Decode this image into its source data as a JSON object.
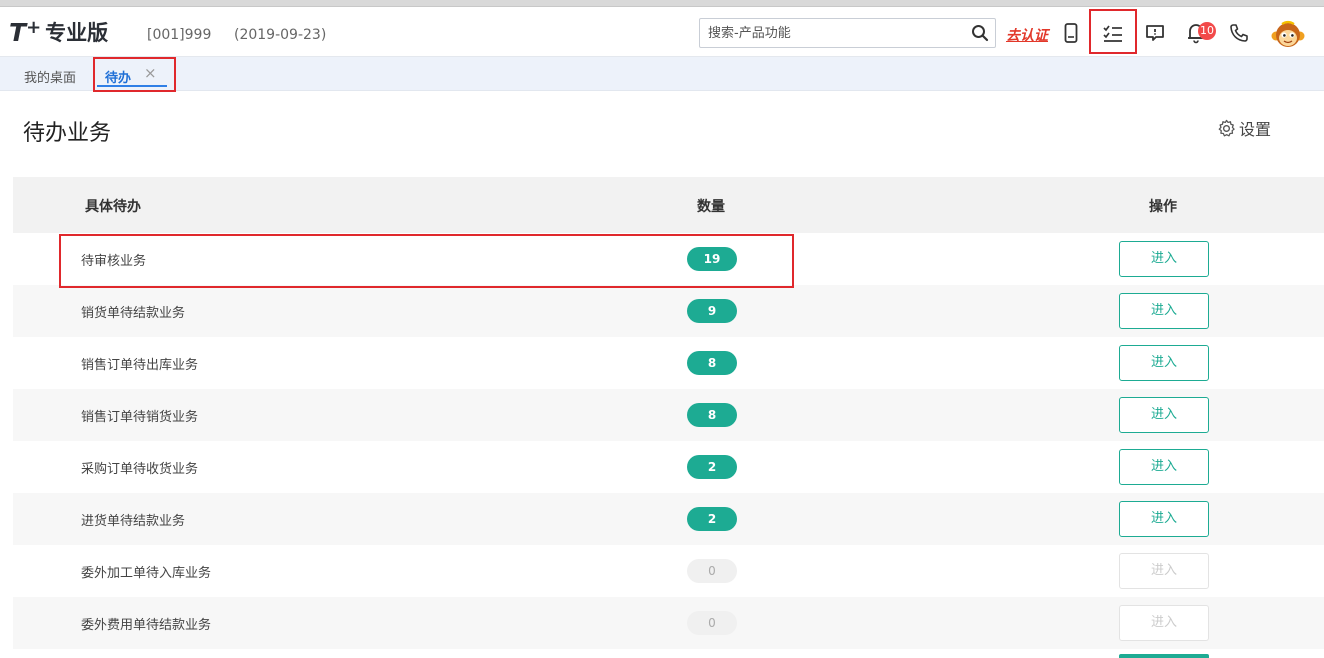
{
  "header": {
    "logo_t": "T",
    "logo_plus": "+",
    "edition": "专业版",
    "account": "[001]999",
    "date": "(2019-09-23)",
    "search_placeholder": "搜索-产品功能",
    "verify_link": "去认证",
    "notification_count": "10",
    "icons": [
      "search-icon",
      "mobile-icon",
      "task-list-icon",
      "message-icon",
      "bell-icon",
      "phone-icon",
      "monkey-avatar"
    ]
  },
  "tabs": {
    "home": "我的桌面",
    "active": "待办",
    "close": "×"
  },
  "page": {
    "title": "待办业务",
    "settings": "设置"
  },
  "table": {
    "headers": {
      "item": "具体待办",
      "count": "数量",
      "action": "操作"
    },
    "rows": [
      {
        "name": "待审核业务",
        "count": "19",
        "action": "进入",
        "enabled": true
      },
      {
        "name": "销货单待结款业务",
        "count": "9",
        "action": "进入",
        "enabled": true
      },
      {
        "name": "销售订单待出库业务",
        "count": "8",
        "action": "进入",
        "enabled": true
      },
      {
        "name": "销售订单待销货业务",
        "count": "8",
        "action": "进入",
        "enabled": true
      },
      {
        "name": "采购订单待收货业务",
        "count": "2",
        "action": "进入",
        "enabled": true
      },
      {
        "name": "进货单待结款业务",
        "count": "2",
        "action": "进入",
        "enabled": true
      },
      {
        "name": "委外加工单待入库业务",
        "count": "0",
        "action": "进入",
        "enabled": false
      },
      {
        "name": "委外费用单待结款业务",
        "count": "0",
        "action": "进入",
        "enabled": false
      }
    ]
  },
  "colors": {
    "accent_green": "#1dab93",
    "tab_blue": "#2f7fe6",
    "highlight_red": "#e0282c",
    "badge_red": "#f24a4a"
  }
}
